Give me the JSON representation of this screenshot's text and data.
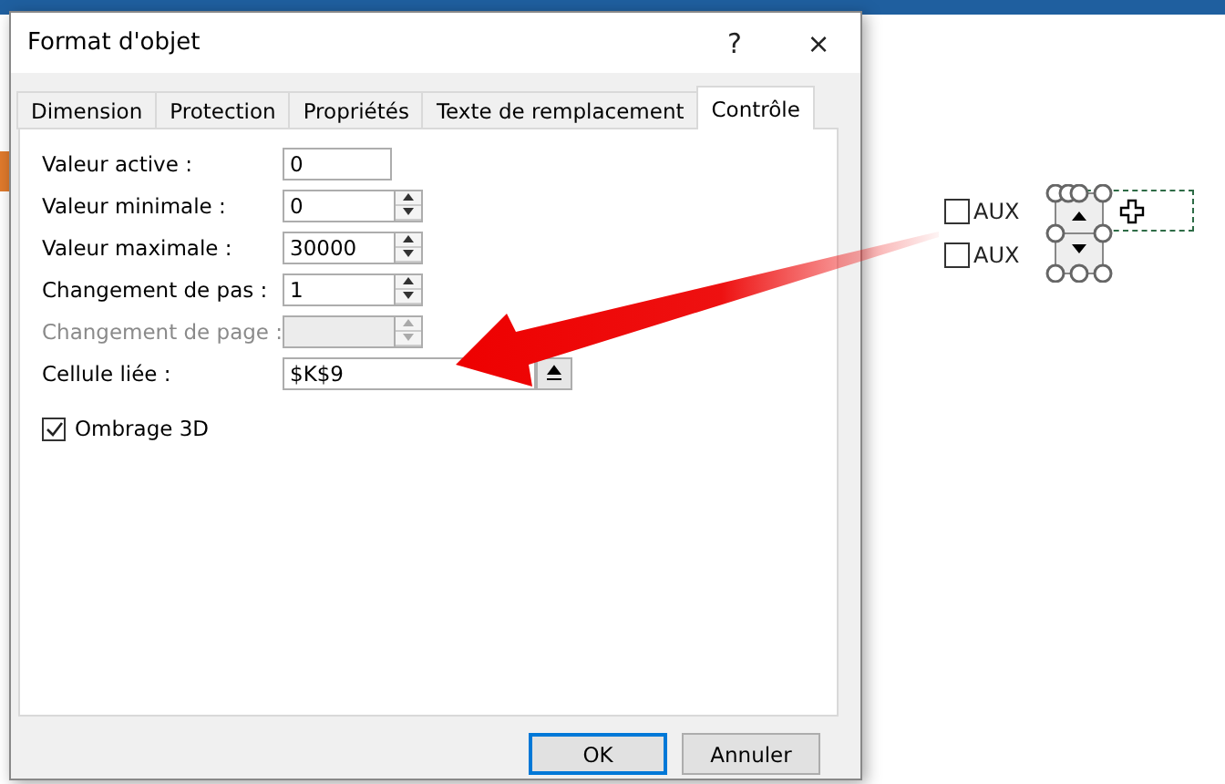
{
  "dialog": {
    "title": "Format d'objet",
    "help": "?",
    "close": "×"
  },
  "tabs": [
    {
      "label": "Dimension",
      "selected": false
    },
    {
      "label": "Protection",
      "selected": false
    },
    {
      "label": "Propriétés",
      "selected": false
    },
    {
      "label": "Texte de remplacement",
      "selected": false
    },
    {
      "label": "Contrôle",
      "selected": true
    }
  ],
  "fields": [
    {
      "label": "Valeur active :",
      "value": "0",
      "kind": "text",
      "disabled": false
    },
    {
      "label": "Valeur minimale :",
      "value": "0",
      "kind": "spinner",
      "disabled": false
    },
    {
      "label": "Valeur maximale :",
      "value": "30000",
      "kind": "spinner",
      "disabled": false
    },
    {
      "label": "Changement de pas :",
      "value": "1",
      "kind": "spinner",
      "disabled": false
    },
    {
      "label": "Changement de page :",
      "kind": "spinner",
      "disabled": true
    },
    {
      "label": "Cellule liée :",
      "value": "$K$9",
      "kind": "ref",
      "disabled": false
    }
  ],
  "shading": {
    "label": "Ombrage 3D",
    "checked": true
  },
  "buttons": [
    {
      "label": "OK",
      "default": true
    },
    {
      "label": "Annuler",
      "default": false
    }
  ],
  "sheet": {
    "checkboxes": [
      {
        "label": "AUX",
        "checked": false
      },
      {
        "label": "AUX",
        "checked": false
      }
    ]
  }
}
